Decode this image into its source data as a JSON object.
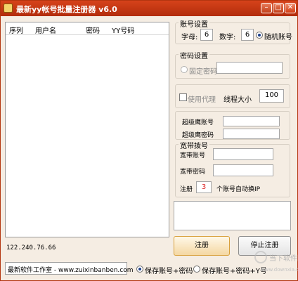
{
  "window": {
    "title": "最新yy帐号批量注册器 v6.0",
    "controls": {
      "minimize": "–",
      "maximize": "□",
      "close": "✕"
    }
  },
  "accounts_list": {
    "columns": [
      "序列",
      "用户名",
      "密码",
      "YY号码"
    ],
    "rows": []
  },
  "ip_address": "122.240.76.66",
  "status_bar": {
    "studio_text": "最新软件工作室 - www.zuixinbanben.com"
  },
  "save_options": [
    {
      "label": "保存账号+密码",
      "selected": true
    },
    {
      "label": "保存账号+密码+Y号",
      "selected": false
    }
  ],
  "account_settings": {
    "title": "账号设置",
    "letters_label": "字母:",
    "letters_value": "6",
    "digits_label": "数字:",
    "digits_value": "6",
    "random_label": "随机账号",
    "random_selected": true
  },
  "password_settings": {
    "title": "密码设置",
    "fixed_label": "固定密码",
    "fixed_selected": false,
    "fixed_value": ""
  },
  "proxy_settings": {
    "use_proxy_label": "使用代理",
    "use_proxy_checked": false,
    "threads_label": "线程大小",
    "threads_value": "100"
  },
  "super_verify": {
    "account_label": "超级鹰账号",
    "account_value": "",
    "password_label": "超级鹰密码",
    "password_value": ""
  },
  "broadband": {
    "title": "宽带拨号",
    "account_label": "宽带账号",
    "account_value": "",
    "password_label": "宽带密码",
    "password_value": "",
    "register_prefix": "注册",
    "register_count": "3",
    "register_suffix": "个账号自动换IP"
  },
  "log_text": "",
  "buttons": {
    "register": "注册",
    "stop": "停止注册"
  },
  "watermark": {
    "text": "当下软件园",
    "url": "www.downxia.com"
  },
  "colors": {
    "titlebar": "#c0360f",
    "window_bg": "#f5ede3",
    "accent_red": "#d22222"
  }
}
